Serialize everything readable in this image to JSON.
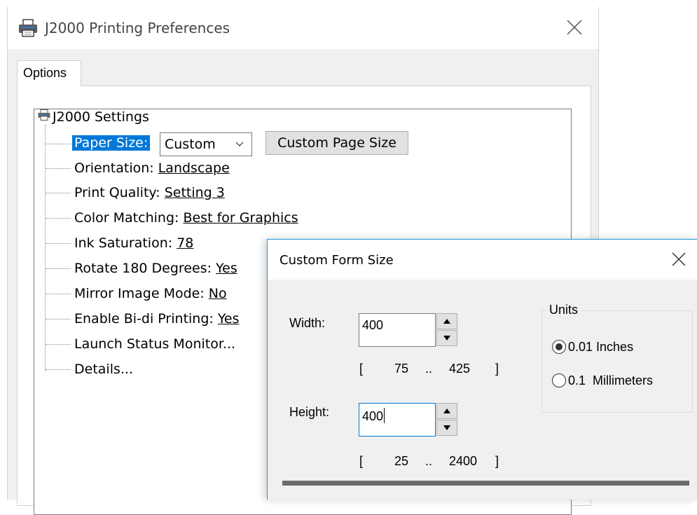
{
  "main_window": {
    "title": "J2000 Printing Preferences",
    "tabs": [
      {
        "label": "Options"
      }
    ]
  },
  "tree": {
    "root_label": "J2000 Settings",
    "paper_size": {
      "label": "Paper Size:",
      "selected": "Custom",
      "custom_button": "Custom Page Size"
    },
    "items": [
      {
        "label": "Orientation: ",
        "value": "Landscape"
      },
      {
        "label": "Print Quality: ",
        "value": "Setting 3"
      },
      {
        "label": "Color Matching: ",
        "value": "Best for Graphics"
      },
      {
        "label": "Ink Saturation: ",
        "value": "78"
      },
      {
        "label": "Rotate 180 Degrees: ",
        "value": "Yes"
      },
      {
        "label": "Mirror Image Mode: ",
        "value": "No"
      },
      {
        "label": "Enable Bi-di Printing: ",
        "value": "Yes"
      },
      {
        "label": "Launch Status Monitor...",
        "value": ""
      },
      {
        "label": "Details...",
        "value": ""
      }
    ]
  },
  "dialog": {
    "title": "Custom Form Size",
    "width": {
      "label": "Width:",
      "value": "400",
      "range_open": "[",
      "range_min": "75",
      "range_sep": "..",
      "range_max": "425",
      "range_close": "]"
    },
    "height": {
      "label": "Height:",
      "value": "400",
      "range_open": "[",
      "range_min": "25",
      "range_sep": "..",
      "range_max": "2400",
      "range_close": "]"
    },
    "units": {
      "legend": "Units",
      "options": [
        {
          "label": "0.01 Inches",
          "selected": true
        },
        {
          "label": "0.1  Millimeters",
          "selected": false
        }
      ]
    }
  },
  "colors": {
    "highlight": "#0078d7",
    "dialog_border": "#1d9bd6",
    "window_bg": "#f0f0f0"
  }
}
